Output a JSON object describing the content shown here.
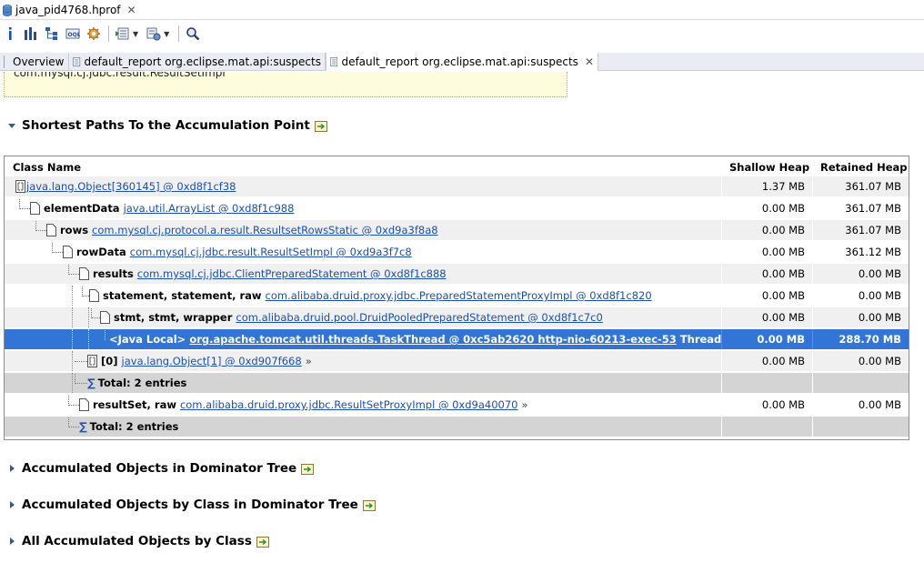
{
  "editor_tab": {
    "title": "java_pid4768.hprof"
  },
  "subtabs": [
    {
      "label": "Overview"
    },
    {
      "label": "default_report  org.eclipse.mat.api:suspects"
    },
    {
      "label": "default_report  org.eclipse.mat.api:suspects"
    }
  ],
  "yellow_box_text": "com.mysql.cj.jdbc.result.ResultSetImpl",
  "sections": {
    "shortest_paths": "Shortest Paths To the Accumulation Point",
    "dominator_tree": "Accumulated Objects in Dominator Tree",
    "by_class_dominator": "Accumulated Objects by Class in Dominator Tree",
    "all_by_class": "All Accumulated Objects by Class"
  },
  "table": {
    "headers": {
      "name": "Class Name",
      "shallow": "Shallow Heap",
      "retained": "Retained Heap"
    },
    "rows": [
      {
        "label": "",
        "link": "java.lang.Object[360145] @ 0xd8f1cf38",
        "suffix": "",
        "shallow": "1.37 MB",
        "retained": "361.07 MB"
      },
      {
        "label": "elementData",
        "link": "java.util.ArrayList @ 0xd8f1c988",
        "suffix": "",
        "shallow": "0.00 MB",
        "retained": "361.07 MB"
      },
      {
        "label": "rows",
        "link": "com.mysql.cj.protocol.a.result.ResultsetRowsStatic @ 0xd9a3f8a8",
        "suffix": "",
        "shallow": "0.00 MB",
        "retained": "361.07 MB"
      },
      {
        "label": "rowData",
        "link": "com.mysql.cj.jdbc.result.ResultSetImpl @ 0xd9a3f7c8",
        "suffix": "",
        "shallow": "0.00 MB",
        "retained": "361.12 MB"
      },
      {
        "label": "results",
        "link": "com.mysql.cj.jdbc.ClientPreparedStatement @ 0xd8f1c888",
        "suffix": "",
        "shallow": "0.00 MB",
        "retained": "0.00 MB"
      },
      {
        "label": "statement, statement, raw",
        "link": "com.alibaba.druid.proxy.jdbc.PreparedStatementProxyImpl @ 0xd8f1c820",
        "suffix": "",
        "shallow": "0.00 MB",
        "retained": "0.00 MB"
      },
      {
        "label": "stmt, stmt, wrapper",
        "link": "com.alibaba.druid.pool.DruidPooledPreparedStatement @ 0xd8f1c7c0",
        "suffix": "",
        "shallow": "0.00 MB",
        "retained": "0.00 MB"
      },
      {
        "label": "<Java Local>",
        "link": "org.apache.tomcat.util.threads.TaskThread @ 0xc5ab2620  http-nio-60213-exec-53",
        "suffix": "Thread",
        "shallow": "0.00 MB",
        "retained": "288.70 MB"
      },
      {
        "label": "[0]",
        "link": "java.lang.Object[1] @ 0xd907f668",
        "suffix": "»",
        "shallow": "0.00 MB",
        "retained": "0.00 MB"
      },
      {
        "label": "Total: 2 entries",
        "link": "",
        "suffix": "",
        "shallow": "",
        "retained": ""
      },
      {
        "label": "resultSet, raw",
        "link": "com.alibaba.druid.proxy.jdbc.ResultSetProxyImpl @ 0xd9a40070",
        "suffix": "»",
        "shallow": "0.00 MB",
        "retained": "0.00 MB"
      },
      {
        "label": "Total: 2 entries",
        "link": "",
        "suffix": "",
        "shallow": "",
        "retained": ""
      }
    ]
  }
}
